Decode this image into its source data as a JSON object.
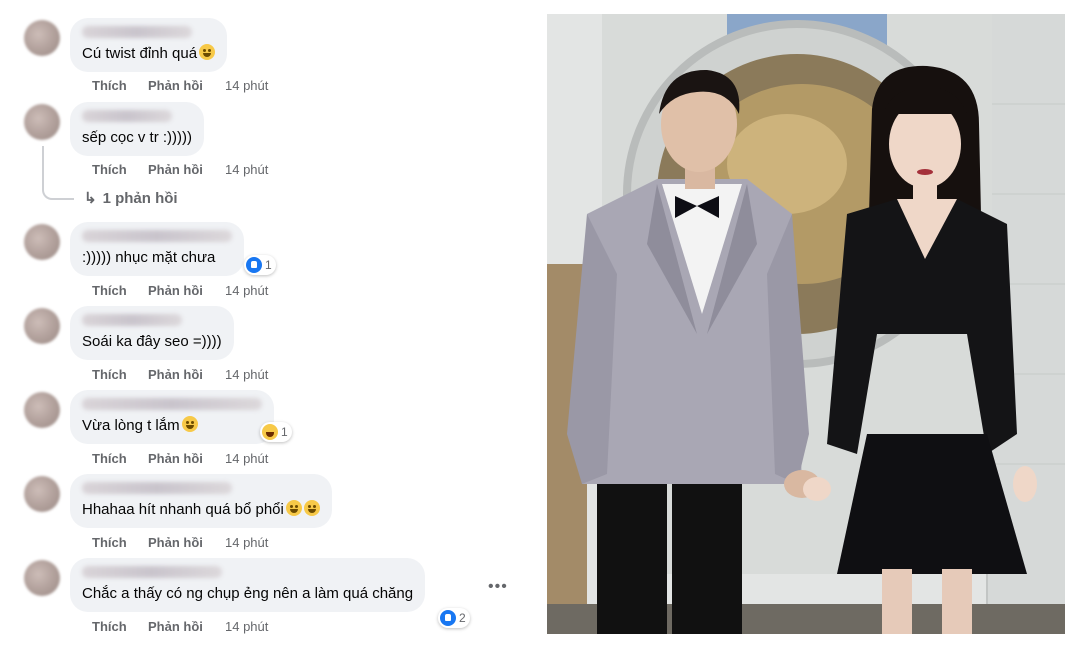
{
  "comments": [
    {
      "text": "Cú twist đỉnh quá",
      "emoji": "crying-laughing",
      "like": "Thích",
      "reply": "Phản hồi",
      "time": "14 phút"
    },
    {
      "text": "sếp cọc v tr :)))))",
      "like": "Thích",
      "reply": "Phản hồi",
      "time": "14 phút"
    },
    {
      "text": ":))))) nhục mặt chưa",
      "reaction_count": "1",
      "like": "Thích",
      "reply": "Phản hồi",
      "time": "14 phút"
    },
    {
      "text": "Soái ka đây seo =))))",
      "like": "Thích",
      "reply": "Phản hồi",
      "time": "14 phút"
    },
    {
      "text": "Vừa lòng t lắm",
      "emoji": "laughing",
      "reaction_count": "1",
      "like": "Thích",
      "reply": "Phản hồi",
      "time": "14 phút"
    },
    {
      "text": "Hhahaa hít nhanh quá bổ phổi",
      "emoji": "grinning-sweat",
      "like": "Thích",
      "reply": "Phản hồi",
      "time": "14 phút"
    },
    {
      "text": "Chắc a thấy có ng chụp ẻng nên a làm quá chăng",
      "reaction_count": "2",
      "like": "Thích",
      "reply": "Phản hồi",
      "time": "14 phút"
    }
  ],
  "replies_link": "1 phản hồi",
  "more_icon": "•••",
  "colors": {
    "bubble": "#f0f2f5",
    "meta": "#65676b",
    "like_blue": "#1877f2"
  },
  "photo": {
    "icon": "photo-icon"
  }
}
